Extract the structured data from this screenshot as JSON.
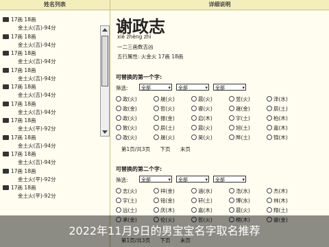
{
  "left_header": "姓名列表",
  "right_header": "详细说明",
  "name_list": [
    {
      "group": "17画 18画",
      "meta": "金土火(吉)-94分"
    },
    {
      "group": "17画 18画",
      "meta": "金土火(吉)-94分"
    },
    {
      "group": "17画 18画",
      "meta": "金土火(吉)-94分"
    },
    {
      "group": "17画 18画",
      "meta": "金土火(吉)-94分"
    },
    {
      "group": "17画 18画",
      "meta": "金土火(吉)-94分"
    },
    {
      "group": "17画 18画",
      "meta": "金土火(吉)-94分"
    },
    {
      "group": "17画 18画",
      "meta": "金土火(平)-92分"
    },
    {
      "group": "17画 18画",
      "meta": "金土火(吉)-94分"
    },
    {
      "group": "17画 18画",
      "meta": "金土火(吉)-94分"
    },
    {
      "group": "17画 18画",
      "meta": "金土火(平)-92分"
    },
    {
      "group": "17画 18画",
      "meta": "金土火(平)-92分"
    }
  ],
  "detail": {
    "name": "谢政志",
    "pinyin": "xiè zhèng zhì",
    "line2": "一二三画数吉凶",
    "line3": "五行属性: 火金火   17画 18画"
  },
  "section1": {
    "title": "可替换的第一个字:",
    "filter_label": "筛选:",
    "dropdowns": [
      "全部",
      "全部",
      "全部"
    ],
    "chars": [
      "政(火)",
      "晟(火)",
      "晨(火)",
      "昱(火)",
      "泽(水)",
      "政(金)",
      "哲(火)",
      "睿(火)",
      "晟(金)",
      "辰(土)",
      "政(火)",
      "振(金)",
      "启(木)",
      "宇(土)",
      "柏(木)",
      "致(火)",
      "辰(土)",
      "晨(火)",
      "旭(土)",
      "嘉(木)",
      "政(火)",
      "晟(火)",
      "昊(火)",
      "晔(土)",
      "锦(木)"
    ],
    "pager": [
      "第1页/共3页",
      "下页",
      "末页"
    ]
  },
  "section2": {
    "title": "可替换的第二个字:",
    "filter_label": "筛选:",
    "dropdowns": [
      "全部",
      "全部",
      "全部"
    ],
    "chars": [
      "志(火)",
      "祥(金)",
      "涵(水)",
      "浩(水)",
      "杰(木)",
      "宇(土)",
      "铭(金)",
      "轩(土)",
      "博(水)",
      "林(木)",
      "远(土)",
      "庆(木)",
      "嘉(木)",
      "晨(火)",
      "翔(土)",
      "承(金)",
      "伦(火)",
      "哲(火)",
      "桐(木)",
      "骏(金)"
    ],
    "pager": [
      "第1页/共3页",
      "下页",
      "末页"
    ]
  },
  "caption": "2022年11月9日的男宝宝名字取名推荐"
}
